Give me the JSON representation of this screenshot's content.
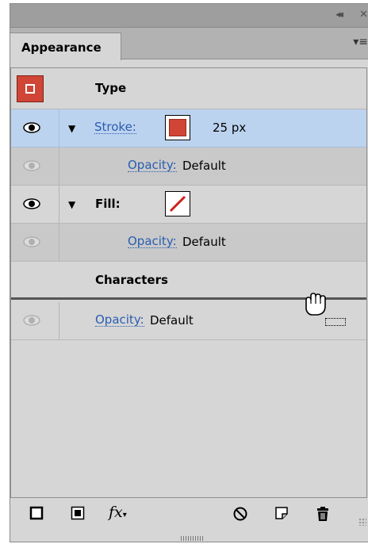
{
  "tab": {
    "label": "Appearance"
  },
  "titlebar": {
    "collapse_glyph": "◂◂",
    "close_glyph": "✕"
  },
  "menu_glyph": "▾≡",
  "object": {
    "type_label": "Type",
    "thumbnail_color": "#d04535"
  },
  "stroke": {
    "label": "Stroke:",
    "weight": "25 px",
    "color": "#d04535"
  },
  "stroke_opacity": {
    "label": "Opacity:",
    "value": "Default"
  },
  "fill": {
    "label": "Fill:",
    "swatch": "none"
  },
  "fill_opacity": {
    "label": "Opacity:",
    "value": "Default"
  },
  "characters": {
    "label": "Characters"
  },
  "object_opacity": {
    "label": "Opacity:",
    "value": "Default"
  },
  "toolbar": {
    "fx_label": "fx",
    "icons": [
      "new-stroke-icon",
      "new-fill-icon",
      "fx-icon",
      "clear-appearance-icon",
      "duplicate-item-icon",
      "delete-icon"
    ]
  }
}
